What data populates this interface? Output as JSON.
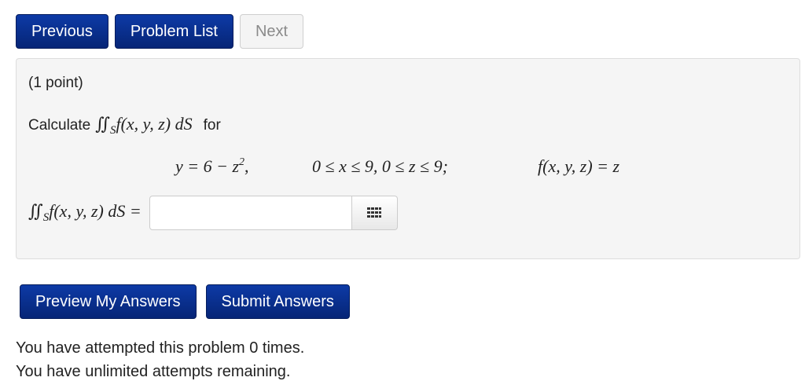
{
  "nav": {
    "previous_label": "Previous",
    "problem_list_label": "Problem List",
    "next_label": "Next"
  },
  "problem": {
    "points": "(1 point)",
    "calculate_label": "Calculate",
    "for_label": "for",
    "integrand": "f(x, y, z) dS",
    "surface_symbol": "S",
    "equation_part1_prefix": "y = 6 − z",
    "equation_part1_exponent": "2",
    "equation_part1_suffix": ",",
    "equation_part2": "0 ≤ x ≤ 9,  0 ≤ z ≤ 9;",
    "equation_part3": "f(x, y, z) = z",
    "answer_prefix": "f(x, y, z) dS =",
    "answer_value": "",
    "answer_placeholder": "",
    "grid_icon": "grid-icon"
  },
  "actions": {
    "preview_label": "Preview My Answers",
    "submit_label": "Submit Answers"
  },
  "status": {
    "attempted": "You have attempted this problem 0 times.",
    "limit": "You have unlimited attempts remaining."
  },
  "colors": {
    "primary_button": "#0a2f8f",
    "panel_background": "#f5f5f5",
    "disabled_text": "#8a8a8a"
  }
}
